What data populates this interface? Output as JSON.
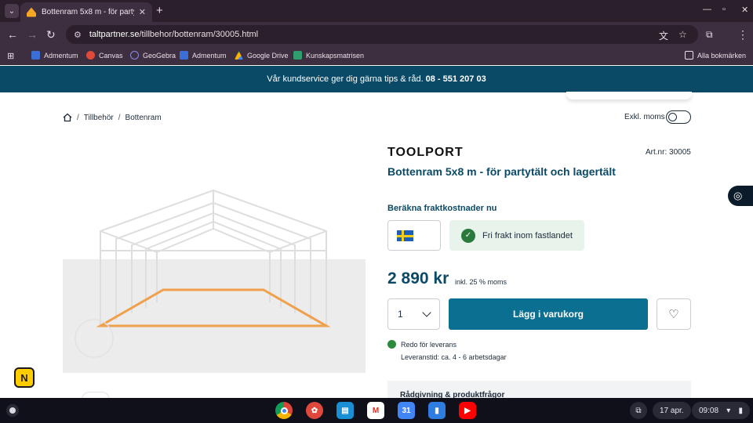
{
  "browser": {
    "tab_title": "Bottenram 5x8 m - för partytält",
    "url_host": "taltpartner.se",
    "url_path": "/tillbehor/bottenram/30005.html",
    "icons": [
      "tab-search-icon",
      "back-icon",
      "forward-icon",
      "reload-icon",
      "site-info-icon",
      "translate-icon",
      "star-icon",
      "extensions-icon",
      "menu-icon"
    ]
  },
  "bookmarks": {
    "items": [
      {
        "label": "Admentum",
        "color": "#3b6fd8"
      },
      {
        "label": "Canvas",
        "color": "#e04a3a"
      },
      {
        "label": "GeoGebra",
        "color": "#6a6ad8"
      },
      {
        "label": "Admentum",
        "color": "#3b6fd8"
      },
      {
        "label": "Google Drive",
        "color": "#f4b400"
      },
      {
        "label": "Kunskapsmatrisen",
        "color": "#2f9e6e"
      }
    ],
    "all_label": "Alla bokmärken"
  },
  "banner": {
    "text": "Vår kundservice ger dig gärna tips & råd.",
    "phone": "08 - 551 207 03"
  },
  "breadcrumb": {
    "items": [
      "Tillbehör",
      "Bottenram"
    ]
  },
  "vat_toggle": {
    "label": "Exkl. moms",
    "on": false
  },
  "product": {
    "brand": "TOOLPORT",
    "art_nr": "Art.nr: 30005",
    "title": "Bottenram 5x8 m - för partytält och lagertält",
    "shipping_heading": "Beräkna fraktkostnader nu",
    "country": "Sverige",
    "free_shipping": "Fri frakt inom fastlandet",
    "price": "2 890 kr",
    "price_note": "inkl. 25 % moms",
    "quantity": "1",
    "add_to_cart": "Lägg i varukorg",
    "stock_status": "Redo för leverans",
    "lead_time": "Leveranstid: ca. 4 - 6 arbetsdagar",
    "advice_heading": "Rådgivning & produktfrågor"
  },
  "colors": {
    "brand_dark": "#0b4a66",
    "button": "#0b6f92",
    "frame_highlight": "#f0a04b",
    "in_stock": "#2b8a3e"
  },
  "shelf": {
    "date": "17 apr.",
    "time": "09:08"
  }
}
